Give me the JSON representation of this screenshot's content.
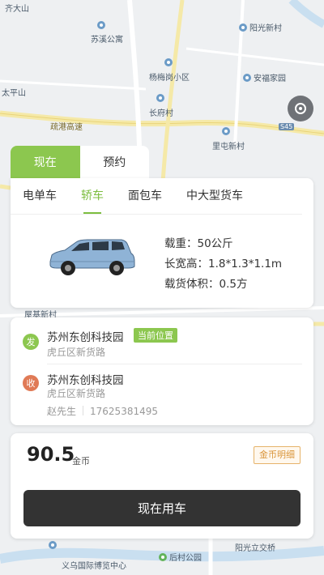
{
  "map": {
    "pois": [
      {
        "label": "齐大山"
      },
      {
        "label": "苏溪公寓"
      },
      {
        "label": "阳光新村"
      },
      {
        "label": "杨梅岗小区"
      },
      {
        "label": "安福家园"
      },
      {
        "label": "太平山"
      },
      {
        "label": "长府村"
      },
      {
        "label": "里屯新村"
      },
      {
        "label": "疏港高速"
      },
      {
        "label": "屋基新村"
      },
      {
        "label": "义乌国际博览中心"
      },
      {
        "label": "后村公园"
      },
      {
        "label": "阳光立交桥"
      },
      {
        "label": "S45"
      }
    ]
  },
  "mode_tabs": [
    {
      "label": "现在",
      "active": true
    },
    {
      "label": "预约",
      "active": false
    }
  ],
  "vehicle_tabs": [
    {
      "label": "电单车",
      "active": false
    },
    {
      "label": "轿车",
      "active": true
    },
    {
      "label": "面包车",
      "active": false
    },
    {
      "label": "中大型货车",
      "active": false
    }
  ],
  "vehicle": {
    "load": "载重：50公斤",
    "size": "长宽高：1.8*1.3*1.1m",
    "volume": "载货体积：0.5方",
    "car_color": "#8fb3d6"
  },
  "sender": {
    "badge": "发",
    "name": "苏州东创科技园",
    "tag": "当前位置",
    "detail": "虎丘区新货路"
  },
  "receiver": {
    "badge": "收",
    "name": "苏州东创科技园",
    "detail": "虎丘区新货路",
    "contact_name": "赵先生",
    "contact_phone": "17625381495"
  },
  "price": {
    "value": "90.5",
    "unit": "金币",
    "detail_label": "金币明细"
  },
  "action": {
    "use_now_label": "现在用车"
  },
  "colors": {
    "accent": "#8cc74f",
    "receiver": "#e07a56",
    "primary_button": "#333333"
  }
}
